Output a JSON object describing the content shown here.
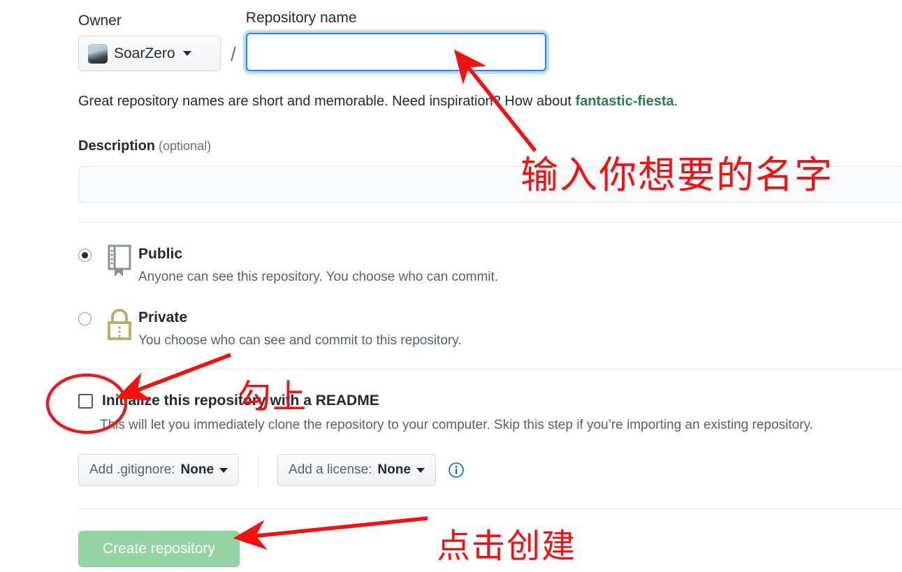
{
  "form": {
    "owner": {
      "label": "Owner",
      "name": "SoarZero",
      "avatar_icon": "user-avatar-photo",
      "caret_icon": "chevron-down-icon"
    },
    "separator": "/",
    "repository_name": {
      "label": "Repository name",
      "value": "",
      "placeholder": ""
    },
    "hint": {
      "text_before": "Great repository names are short and memorable. Need inspiration? How about ",
      "suggestion": "fantastic-fiesta",
      "text_after": "."
    },
    "description": {
      "label": "Description",
      "optional": "(optional)",
      "value": "",
      "placeholder": ""
    },
    "visibility": {
      "options": [
        {
          "id": "public",
          "title": "Public",
          "subtitle": "Anyone can see this repository. You choose who can commit.",
          "selected": true,
          "icon": "repo-book-icon",
          "icon_color": "#8a9199"
        },
        {
          "id": "private",
          "title": "Private",
          "subtitle": "You choose who can see and commit to this repository.",
          "selected": false,
          "icon": "lock-icon",
          "icon_color": "#bdae72"
        }
      ]
    },
    "initialize": {
      "label": "Initialize this repository with a README",
      "checked": false,
      "sublabel": "This will let you immediately clone the repository to your computer. Skip this step if you’re importing an existing repository."
    },
    "gitignore": {
      "prefix": "Add .gitignore:",
      "value": "None",
      "caret_icon": "chevron-down-icon"
    },
    "license": {
      "prefix": "Add a license:",
      "value": "None",
      "caret_icon": "chevron-down-icon",
      "info_icon": "info-circle-icon"
    },
    "submit": {
      "label": "Create repository",
      "enabled": false,
      "color": "#94d3a2"
    }
  },
  "annotations": {
    "color": "#f50f0f",
    "items": [
      {
        "id": "name",
        "text": "输入你想要的名字"
      },
      {
        "id": "check",
        "text": "勾上"
      },
      {
        "id": "create",
        "text": "点击创建"
      }
    ]
  }
}
